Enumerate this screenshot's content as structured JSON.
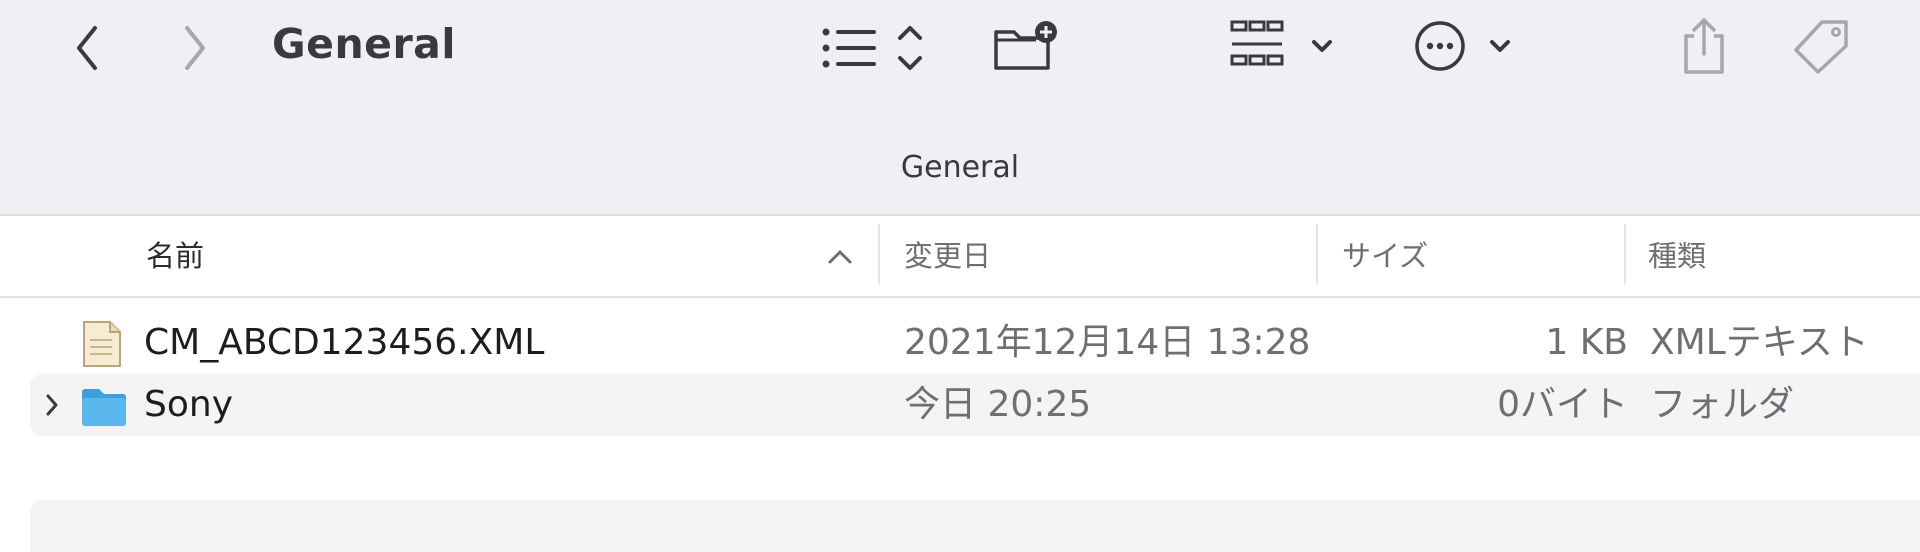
{
  "window": {
    "title": "General"
  },
  "path_bar": {
    "title": "General"
  },
  "toolbar": {
    "back_icon": "chevron-left-icon",
    "forward_icon": "chevron-right-icon",
    "view_icon": "list-view-icon",
    "new_folder_icon": "folder-add-icon",
    "group_icon": "grid-group-icon",
    "more_icon": "ellipsis-circle-icon",
    "share_icon": "share-icon",
    "tag_icon": "tag-icon"
  },
  "columns": {
    "name": "名前",
    "date": "変更日",
    "size": "サイズ",
    "kind": "種類"
  },
  "rows": [
    {
      "name": "CM_ABCD123456.XML",
      "date": "2021年12月14日 13:28",
      "size": "1 KB",
      "kind": "XMLテキスト",
      "icon": "xml-document-icon"
    },
    {
      "name": "Sony",
      "date": "今日 20:25",
      "size": "0バイト",
      "kind": "フォルダ",
      "icon": "folder-icon"
    }
  ],
  "colors": {
    "toolbar_bg": "#f1eff3",
    "folder_blue": "#5ab8ef",
    "row_alt": "#f4f4f5"
  }
}
